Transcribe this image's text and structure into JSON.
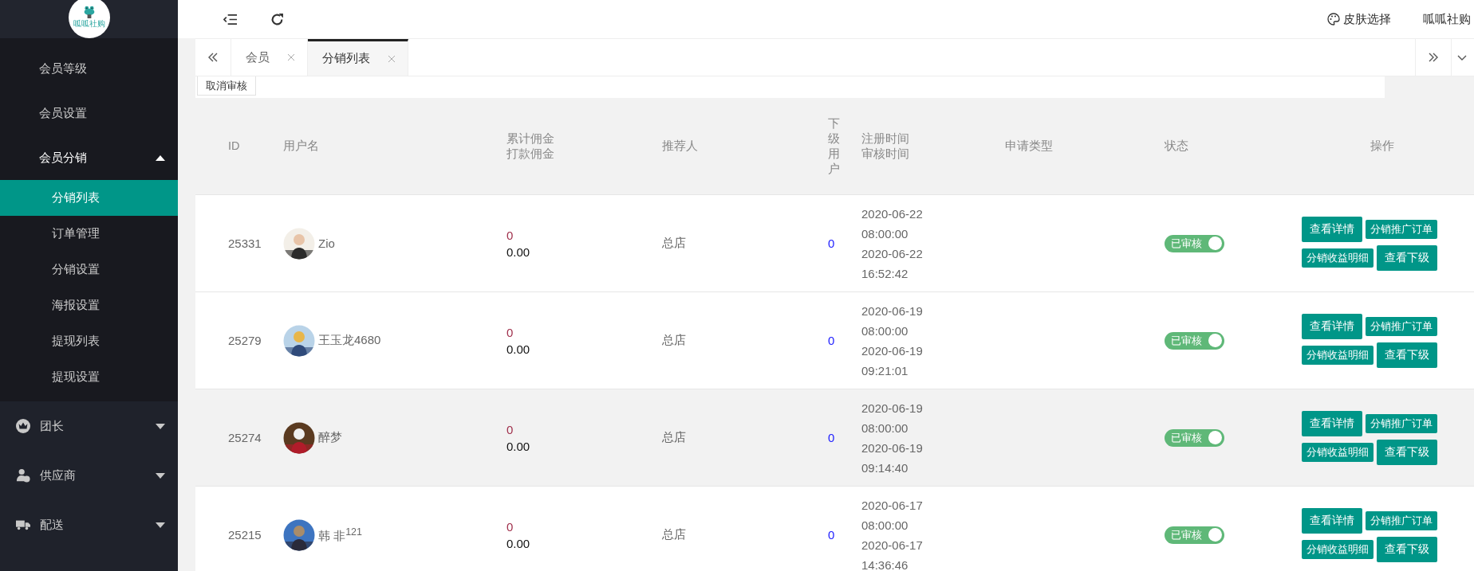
{
  "logo": {
    "text": "呱呱社购"
  },
  "header": {
    "skin_label": "皮肤选择",
    "user": "呱呱社购"
  },
  "sidebar": {
    "items": [
      {
        "label": "会员等级",
        "kind": "sub-plain"
      },
      {
        "label": "会员设置",
        "kind": "sub-plain"
      },
      {
        "label": "会员分销",
        "kind": "group",
        "expanded": true,
        "children": [
          {
            "label": "分销列表",
            "selected": true
          },
          {
            "label": "订单管理",
            "selected": false
          },
          {
            "label": "分销设置",
            "selected": false
          },
          {
            "label": "海报设置",
            "selected": false
          },
          {
            "label": "提现列表",
            "selected": false
          },
          {
            "label": "提现设置",
            "selected": false
          }
        ]
      },
      {
        "label": "团长",
        "kind": "top",
        "expanded": false
      },
      {
        "label": "供应商",
        "kind": "top",
        "expanded": false
      },
      {
        "label": "配送",
        "kind": "top",
        "expanded": false
      }
    ]
  },
  "tabs": [
    {
      "label": "会员",
      "selected": false
    },
    {
      "label": "分销列表",
      "selected": true
    }
  ],
  "toolbar": {
    "buttons": [
      "取消审核"
    ]
  },
  "table": {
    "columns": [
      "ID",
      "用户名",
      "累计佣金打款佣金",
      "推荐人",
      "下级用户",
      "注册时间审核时间",
      "申请类型",
      "状态",
      "操作"
    ],
    "rows": [
      {
        "id": "25331",
        "name": "Zio",
        "total": "0",
        "paid": "0.00",
        "referrer": "总店",
        "subordinates": "0",
        "registered": "2020-06-22 08:00:00",
        "reviewed": "2020-06-22 16:52:42",
        "status": "已审核",
        "approved": true,
        "highlighted": false,
        "actions": [
          "查看详情",
          "分销推广订单",
          "分销收益明细",
          "查看下级"
        ]
      },
      {
        "id": "25279",
        "name": "王玉龙4680",
        "total": "0",
        "paid": "0.00",
        "referrer": "总店",
        "subordinates": "0",
        "registered": "2020-06-19 08:00:00",
        "reviewed": "2020-06-19 09:21:01",
        "status": "已审核",
        "approved": true,
        "highlighted": false,
        "actions": [
          "查看详情",
          "分销推广订单",
          "分销收益明细",
          "查看下级"
        ]
      },
      {
        "id": "25274",
        "name": "醉梦",
        "total": "0",
        "paid": "0.00",
        "referrer": "总店",
        "subordinates": "0",
        "registered": "2020-06-19 08:00:00",
        "reviewed": "2020-06-19 09:14:40",
        "status": "已审核",
        "approved": true,
        "highlighted": true,
        "actions": [
          "查看详情",
          "分销推广订单",
          "分销收益明细",
          "查看下级"
        ]
      },
      {
        "id": "25215",
        "name": "韩 非$^{121}$",
        "total": "0",
        "paid": "0.00",
        "referrer": "总店",
        "subordinates": "0",
        "registered": "2020-06-17 08:00:00",
        "reviewed": "2020-06-17 14:36:46",
        "status": "已审核",
        "approved": true,
        "highlighted": false,
        "actions": [
          "查看详情",
          "分销推广订单",
          "分销收益明细",
          "查看下级"
        ]
      }
    ]
  }
}
